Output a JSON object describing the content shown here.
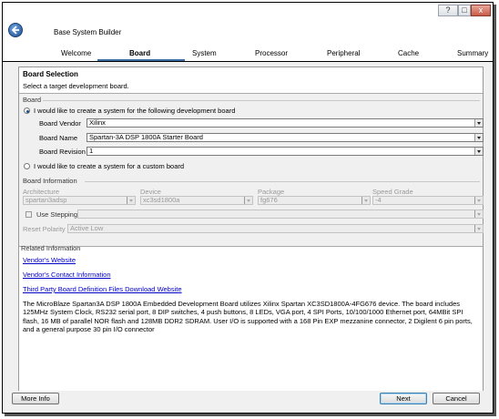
{
  "window": {
    "help_glyph": "?",
    "maximize_glyph": "□",
    "close_glyph": "x"
  },
  "app": {
    "title": "Base System Builder"
  },
  "tabs": [
    {
      "label": "Welcome"
    },
    {
      "label": "Board"
    },
    {
      "label": "System"
    },
    {
      "label": "Processor"
    },
    {
      "label": "Peripheral"
    },
    {
      "label": "Cache"
    },
    {
      "label": "Summary"
    }
  ],
  "header": {
    "title": "Board Selection",
    "subtitle": "Select a target development board."
  },
  "board_group": {
    "legend": "Board",
    "option_dev": "I would like to create a system for the following development board",
    "vendor_label": "Board Vendor",
    "vendor_value": "Xilinx",
    "name_label": "Board Name",
    "name_value": "Spartan-3A DSP 1800A Starter Board",
    "revision_label": "Board Revision",
    "revision_value": "1",
    "option_custom": "I would like to create a system for a custom board"
  },
  "board_info": {
    "legend": "Board Information",
    "architecture_label": "Architecture",
    "architecture_value": "spartan3adsp",
    "device_label": "Device",
    "device_value": "xc3sd1800a",
    "package_label": "Package",
    "package_value": "fg676",
    "speed_label": "Speed Grade",
    "speed_value": "-4",
    "stepping_label": "Use Stepping",
    "reset_label": "Reset Polarity",
    "reset_value": "Active Low"
  },
  "related": {
    "legend": "Related Information",
    "link_vendor": "Vendor's Website",
    "link_contact": "Vendor's Contact Information",
    "link_third_party": "Third Party Board Definition Files Download Website",
    "description": "The MicroBlaze Spartan3A DSP 1800A Embedded Development Board utilizes Xilinx Spartan XC3SD1800A-4FG676 device. The board includes 125MHz System Clock, RS232 serial port, 8 DIP switches, 4 push buttons, 8 LEDs, VGA port, 4 SPI Ports, 10/100/1000 Ethernet port, 64MBit SPI flash, 16 MB of parallel NOR flash and 128MB DDR2 SDRAM. User I/O is supported with a 168 Pin EXP mezzanine connector, 2 Digilent 6 pin ports, and a general purpose 30 pin I/O connector"
  },
  "footer": {
    "more_info": "More Info",
    "next": "Next",
    "cancel": "Cancel"
  }
}
